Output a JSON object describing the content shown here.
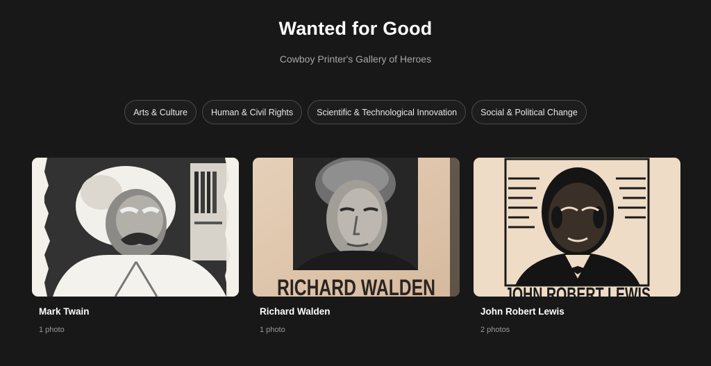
{
  "header": {
    "title": "Wanted for Good",
    "subtitle": "Cowboy Printer's Gallery of Heroes"
  },
  "filters": [
    {
      "label": "Arts & Culture"
    },
    {
      "label": "Human & Civil Rights"
    },
    {
      "label": "Scientific & Technological Innovation"
    },
    {
      "label": "Social & Political Change"
    }
  ],
  "cards": [
    {
      "name": "Mark Twain",
      "count": "1 photo",
      "image_icon": "portrait-mark-twain"
    },
    {
      "name": "Richard Walden",
      "count": "1 photo",
      "image_icon": "portrait-richard-walden",
      "poster_text": "RICHARD WALDEN"
    },
    {
      "name": "John Robert Lewis",
      "count": "2 photos",
      "image_icon": "portrait-john-robert-lewis",
      "poster_text": "JOHN ROBERT LEWIS"
    }
  ],
  "colors": {
    "background": "#181818",
    "chip_border": "#4a4a4a",
    "subtitle": "#a7a7a7",
    "paper": "#ead4bb"
  }
}
